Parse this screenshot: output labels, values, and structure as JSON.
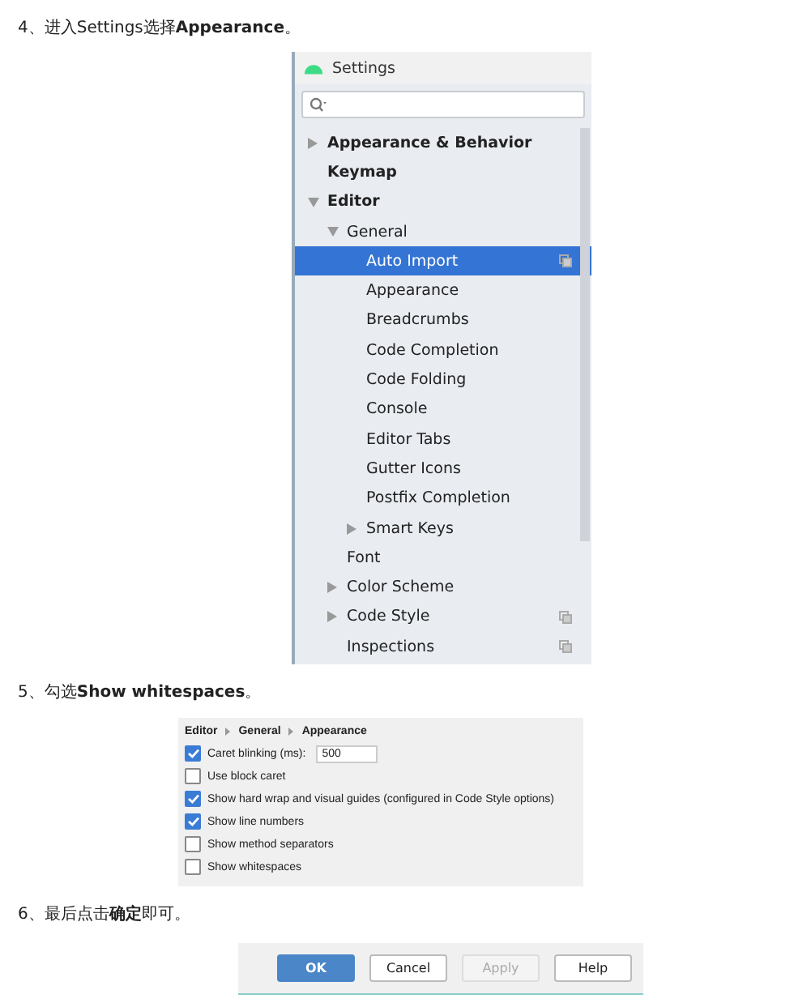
{
  "steps": [
    {
      "text": "4、进入Settings选择**Appearance**。"
    },
    {
      "text": "5、勾选**Show whitespaces**。"
    },
    {
      "text": "6、最后点击**确定**即可。"
    }
  ],
  "settings": {
    "title": "Settings",
    "tree": [
      {
        "label": "Appearance & Behavior",
        "expanded": false,
        "selected": false,
        "shared": false
      },
      {
        "label": "Keymap",
        "selected": false,
        "shared": false
      },
      {
        "label": "Editor",
        "expanded": true,
        "selected": false,
        "shared": false,
        "children": [
          {
            "label": "General",
            "expanded": true,
            "selected": false,
            "shared": false,
            "children": [
              {
                "label": "Auto Import",
                "selected": true,
                "shared": true
              },
              {
                "label": "Appearance",
                "selected": false,
                "shared": false
              },
              {
                "label": "Breadcrumbs",
                "selected": false,
                "shared": false
              },
              {
                "label": "Code Completion",
                "selected": false,
                "shared": false
              },
              {
                "label": "Code Folding",
                "selected": false,
                "shared": false
              },
              {
                "label": "Console",
                "selected": false,
                "shared": false
              },
              {
                "label": "Editor Tabs",
                "selected": false,
                "shared": false
              },
              {
                "label": "Gutter Icons",
                "selected": false,
                "shared": false
              },
              {
                "label": "Postfix Completion",
                "selected": false,
                "shared": false
              },
              {
                "label": "Smart Keys",
                "expanded": false,
                "selected": false,
                "shared": false
              }
            ]
          },
          {
            "label": "Font",
            "selected": false,
            "shared": false
          },
          {
            "label": "Color Scheme",
            "expanded": false,
            "selected": false,
            "shared": false
          },
          {
            "label": "Code Style",
            "expanded": false,
            "selected": false,
            "shared": true
          },
          {
            "label": "Inspections",
            "selected": false,
            "shared": true
          }
        ]
      }
    ]
  },
  "appearance": {
    "breadcrumb": [
      "Editor",
      "General",
      "Appearance"
    ],
    "options": [
      {
        "label": "Caret blinking (ms):",
        "checked": true,
        "value": "500"
      },
      {
        "label": "Use block caret",
        "checked": false
      },
      {
        "label": "Show hard wrap and visual guides (configured in Code Style options)",
        "checked": true
      },
      {
        "label": "Show line numbers",
        "checked": true
      },
      {
        "label": "Show method separators",
        "checked": false
      },
      {
        "label": "Show whitespaces",
        "checked": false
      }
    ]
  },
  "buttons": [
    {
      "label": "OK",
      "kind": "primary",
      "disabled": false
    },
    {
      "label": "Cancel",
      "kind": "normal",
      "disabled": false
    },
    {
      "label": "Apply",
      "kind": "normal",
      "disabled": true
    },
    {
      "label": "Help",
      "kind": "normal",
      "disabled": false
    }
  ]
}
